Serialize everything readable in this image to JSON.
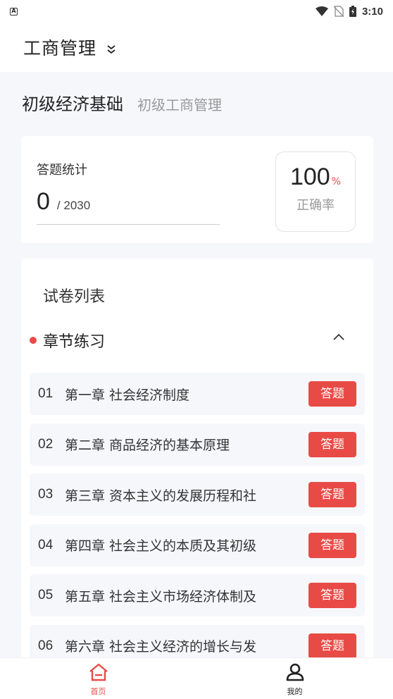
{
  "status_bar": {
    "time": "3:10",
    "app_icon_letter": "A"
  },
  "top_bar": {
    "subject": "工商管理",
    "dropdown_icon": "double-chevron-down-icon"
  },
  "book": {
    "title": "初级经济基础",
    "subtitle": "初级工商管理"
  },
  "stats": {
    "label": "答题统计",
    "answered": "0",
    "total": "/ 2030",
    "rate_value": "100",
    "rate_unit": "%",
    "rate_label": "正确率"
  },
  "papers": {
    "title": "试卷列表",
    "section_label": "章节练习",
    "toggle_icon": "chevron-up-icon",
    "chapters": [
      {
        "num": "01",
        "title": "第一章 社会经济制度",
        "action": "答题"
      },
      {
        "num": "02",
        "title": "第二章 商品经济的基本原理",
        "action": "答题"
      },
      {
        "num": "03",
        "title": "第三章 资本主义的发展历程和社",
        "action": "答题"
      },
      {
        "num": "04",
        "title": "第四章 社会主义的本质及其初级",
        "action": "答题"
      },
      {
        "num": "05",
        "title": "第五章 社会主义市场经济体制及",
        "action": "答题"
      },
      {
        "num": "06",
        "title": "第六章 社会主义经济的增长与发",
        "action": "答题"
      }
    ]
  },
  "tab_bar": {
    "tabs": [
      {
        "label": "首页",
        "icon": "home-icon",
        "active": true
      },
      {
        "label": "我的",
        "icon": "user-icon",
        "active": false
      }
    ]
  },
  "colors": {
    "accent": "#e84a45",
    "background": "#f6f7fb",
    "card": "#ffffff"
  }
}
